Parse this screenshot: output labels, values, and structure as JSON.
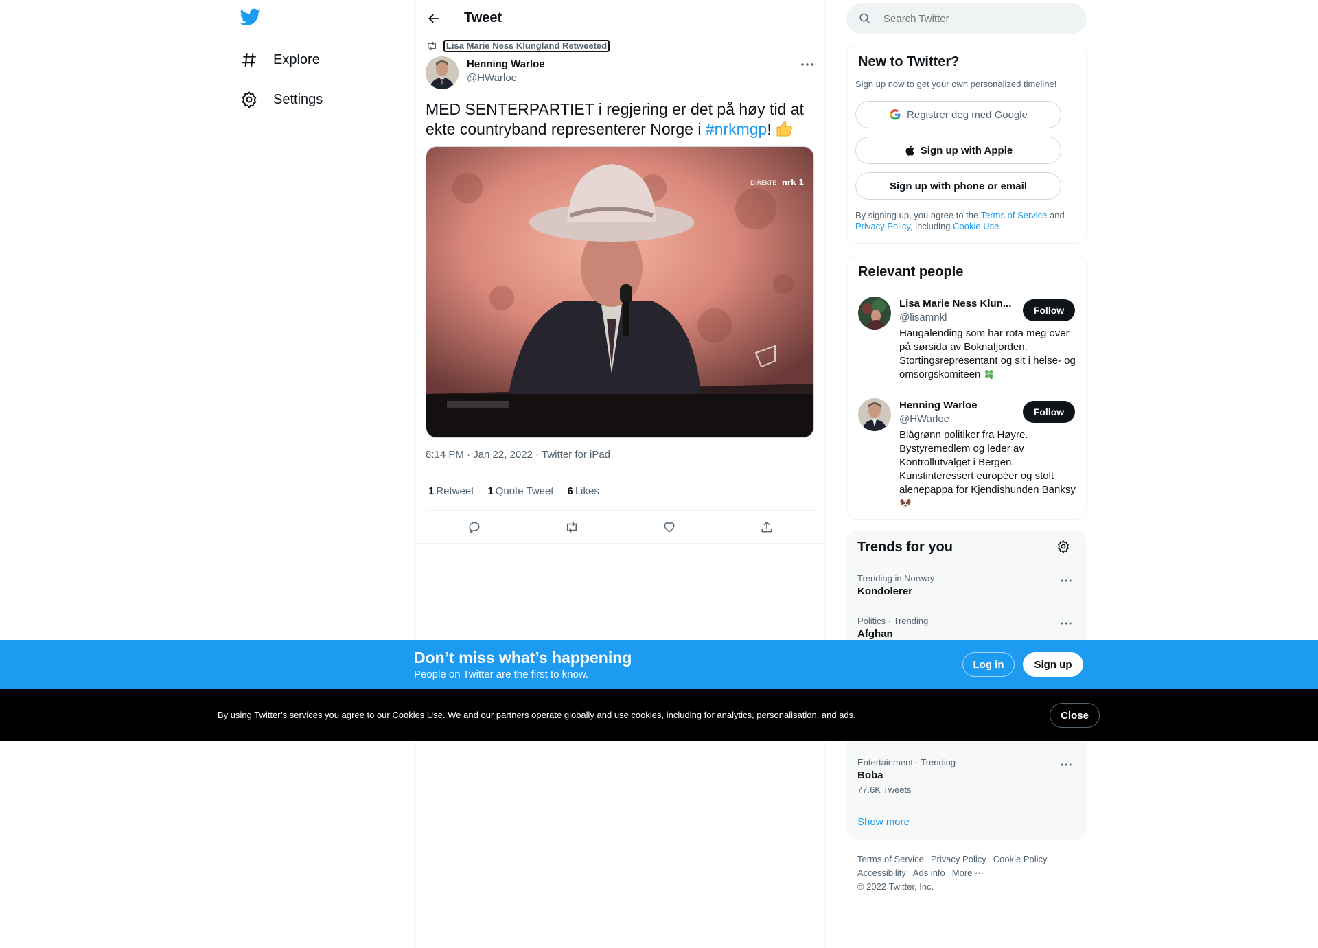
{
  "nav": {
    "logo_icon": "twitter-bird-icon",
    "items": [
      {
        "label": "Explore",
        "icon": "hashtag-icon"
      },
      {
        "label": "Settings",
        "icon": "gear-icon"
      }
    ]
  },
  "main": {
    "header_title": "Tweet",
    "retweeted_by": "Lisa Marie Ness Klungland Retweeted",
    "author": {
      "name": "Henning Warloe",
      "handle": "@HWarloe"
    },
    "text_before": "MED SENTERPARTIET i regjering er det på høy tid at ekte countryband representerer Norge i ",
    "hashtag": "#nrkmgp",
    "text_after": "!",
    "timestamp": "8:14 PM · Jan 22, 2022 · Twitter for iPad",
    "stats": [
      {
        "count": "1",
        "label": "Retweet"
      },
      {
        "count": "1",
        "label": "Quote Tweet"
      },
      {
        "count": "6",
        "label": "Likes"
      }
    ],
    "media_overlay": {
      "live": "DIREKTE",
      "channel": "nrk 1"
    }
  },
  "right": {
    "search_placeholder": "Search Twitter",
    "new_to_twitter": {
      "title": "New to Twitter?",
      "subtitle": "Sign up now to get your own personalized timeline!",
      "google_label": "Registrer deg med Google",
      "apple_label": "Sign up with Apple",
      "phone_label": "Sign up with phone or email",
      "legal_prefix": "By signing up, you agree to the ",
      "terms": "Terms of Service",
      "and": " and",
      "privacy": "Privacy Policy",
      "including": ", including ",
      "cookie": "Cookie Use."
    },
    "relevant_people": {
      "title": "Relevant people",
      "people": [
        {
          "name": "Lisa Marie Ness Klun...",
          "handle": "@lisamnkl",
          "bio": "Haugalending som har rota meg over på sørsida av Boknafjorden. Stortingsrepresentant og sit i helse- og omsorgskomiteen",
          "follow": "Follow"
        },
        {
          "name": "Henning Warloe",
          "handle": "@HWarloe",
          "bio": "Blågrønn politiker fra Høyre. Bystyremedlem og leder av Kontrollutvalget i Bergen. Kunstinteressert européer og stolt alenepappa for Kjendishunden Banksy",
          "follow": "Follow"
        }
      ]
    },
    "trends": {
      "title": "Trends for you",
      "items": [
        {
          "context": "Trending in Norway",
          "name": "Kondolerer",
          "count": ""
        },
        {
          "context": "Politics · Trending",
          "name": "Afghan",
          "count": ""
        },
        {
          "context": "Entertainment · Trending",
          "name": "Boba",
          "count": "77.6K Tweets"
        }
      ],
      "show_more": "Show more"
    },
    "footer": {
      "links": [
        "Terms of Service",
        "Privacy Policy",
        "Cookie Policy",
        "Accessibility",
        "Ads info",
        "More ···"
      ],
      "copyright": "© 2022 Twitter, Inc."
    }
  },
  "signup_bar": {
    "title": "Don’t miss what’s happening",
    "subtitle": "People on Twitter are the first to know.",
    "login": "Log in",
    "signup": "Sign up"
  },
  "cookie_bar": {
    "text": "By using Twitter’s services you agree to our Cookies Use. We and our partners operate globally and use cookies, including for analytics, personalisation, and ads.",
    "close": "Close"
  },
  "colors": {
    "accent": "#1d9bf0",
    "text": "#0f1419",
    "secondary": "#536471",
    "cookie_bg": "#000000"
  }
}
